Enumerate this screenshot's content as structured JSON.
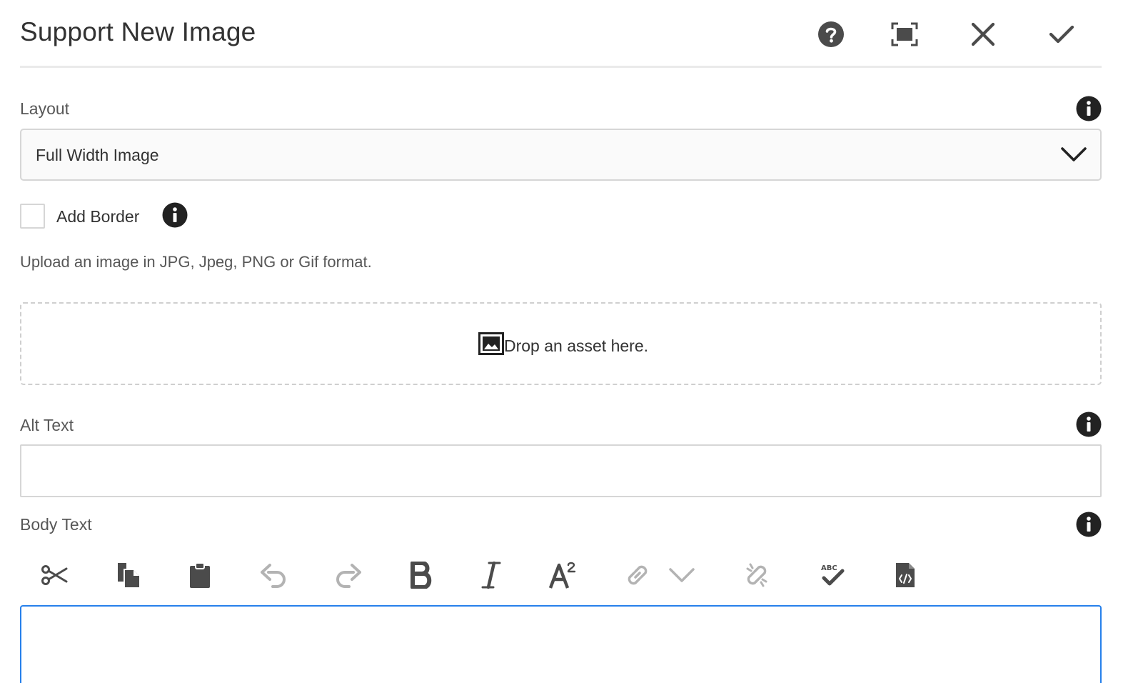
{
  "dialog": {
    "title": "Support New Image",
    "header_actions": [
      "help-icon",
      "fullscreen-icon",
      "close-icon",
      "done-icon"
    ]
  },
  "layout_field": {
    "label": "Layout",
    "selected": "Full Width Image"
  },
  "border_field": {
    "label": "Add Border",
    "checked": false
  },
  "upload": {
    "help_text": "Upload an image in JPG, Jpeg, PNG or Gif format.",
    "dropzone_text": "Drop an asset here."
  },
  "alt_text_field": {
    "label": "Alt Text",
    "value": ""
  },
  "body_text_field": {
    "label": "Body Text",
    "toolbar": [
      "cut-icon",
      "copy-icon",
      "paste-icon",
      "undo-icon",
      "redo-icon",
      "bold-icon",
      "italic-icon",
      "superscript-icon",
      "link-icon",
      "link-dropdown-chevron-icon",
      "unlink-icon",
      "spellcheck-icon",
      "source-edit-icon"
    ],
    "value": ""
  },
  "colors": {
    "focus_border": "#2680eb",
    "icon_dark": "#4b4b4b",
    "icon_disabled": "#b3b3b3"
  }
}
